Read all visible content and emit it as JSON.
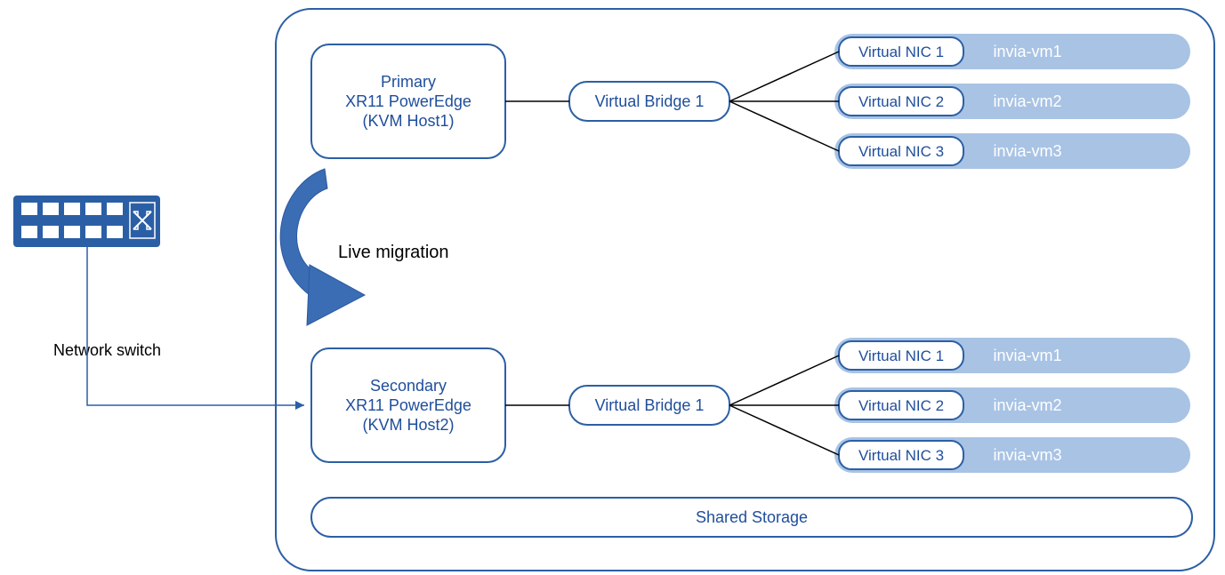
{
  "switch_label": "Network switch",
  "migration_label": "Live migration",
  "cluster": {
    "hosts": [
      {
        "title_line1": "Primary",
        "title_line2": "XR11 PowerEdge",
        "title_line3": "(KVM Host1)",
        "bridge": "Virtual Bridge 1",
        "nics": [
          "Virtual NIC 1",
          "Virtual NIC 2",
          "Virtual NIC 3"
        ],
        "vms": [
          "invia-vm1",
          "invia-vm2",
          "invia-vm3"
        ]
      },
      {
        "title_line1": "Secondary",
        "title_line2": "XR11 PowerEdge",
        "title_line3": "(KVM Host2)",
        "bridge": "Virtual Bridge 1",
        "nics": [
          "Virtual NIC 1",
          "Virtual NIC 2",
          "Virtual NIC 3"
        ],
        "vms": [
          "invia-vm1",
          "invia-vm2",
          "invia-vm3"
        ]
      }
    ],
    "storage": "Shared Storage"
  },
  "colors": {
    "blue": "#2b5fa5",
    "lightblue": "#a8c3e4",
    "textblue": "#1f4e9b",
    "black": "#000000",
    "labeltext": "#ffffff"
  }
}
